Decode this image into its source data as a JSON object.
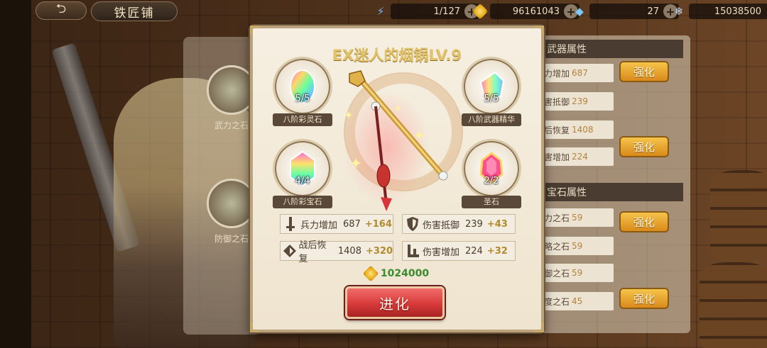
{
  "header": {
    "title": "铁匠铺",
    "resources": [
      {
        "icon": "stamina-bolt-icon",
        "value": "1/127"
      },
      {
        "icon": "gold-coin-icon",
        "value": "96161043"
      },
      {
        "icon": "gem-crystal-icon",
        "value": "27"
      },
      {
        "icon": "silver-snowflake-icon",
        "value": "15038500"
      }
    ]
  },
  "left_list": {
    "items": [
      {
        "label": "武力之石"
      },
      {
        "label": "防御之石"
      }
    ]
  },
  "right_panel": {
    "sections": [
      {
        "heading": "武器属性",
        "rows": [
          {
            "name": "力增加",
            "value": "687"
          },
          {
            "name": "害抵御",
            "value": "239"
          },
          {
            "name": "后恢复",
            "value": "1408"
          },
          {
            "name": "害增加",
            "value": "224"
          }
        ],
        "buttons": [
          "强化",
          "强化"
        ]
      },
      {
        "heading": "宝石属性",
        "rows": [
          {
            "name": "力之石",
            "value": "59"
          },
          {
            "name": "略之石",
            "value": "59"
          },
          {
            "name": "御之石",
            "value": "59"
          },
          {
            "name": "度之石",
            "value": "45"
          }
        ],
        "buttons": [
          "强化",
          "强化"
        ]
      }
    ]
  },
  "modal": {
    "title": "EX迷人的烟锅LV.9",
    "materials": [
      {
        "count": "5/5",
        "label": "八阶彩灵石"
      },
      {
        "count": "5/5",
        "label": "八阶武器精华"
      },
      {
        "count": "4/4",
        "label": "八阶彩宝石"
      },
      {
        "count": "2/2",
        "label": "圣石"
      }
    ],
    "stats": [
      {
        "name": "兵力增加",
        "value": "687",
        "bonus": "+164"
      },
      {
        "name": "伤害抵御",
        "value": "239",
        "bonus": "+43"
      },
      {
        "name": "战后恢复",
        "value": "1408",
        "bonus": "+320"
      },
      {
        "name": "伤害增加",
        "value": "224",
        "bonus": "+32"
      }
    ],
    "cost": "1024000",
    "evolve_label": "进化"
  }
}
